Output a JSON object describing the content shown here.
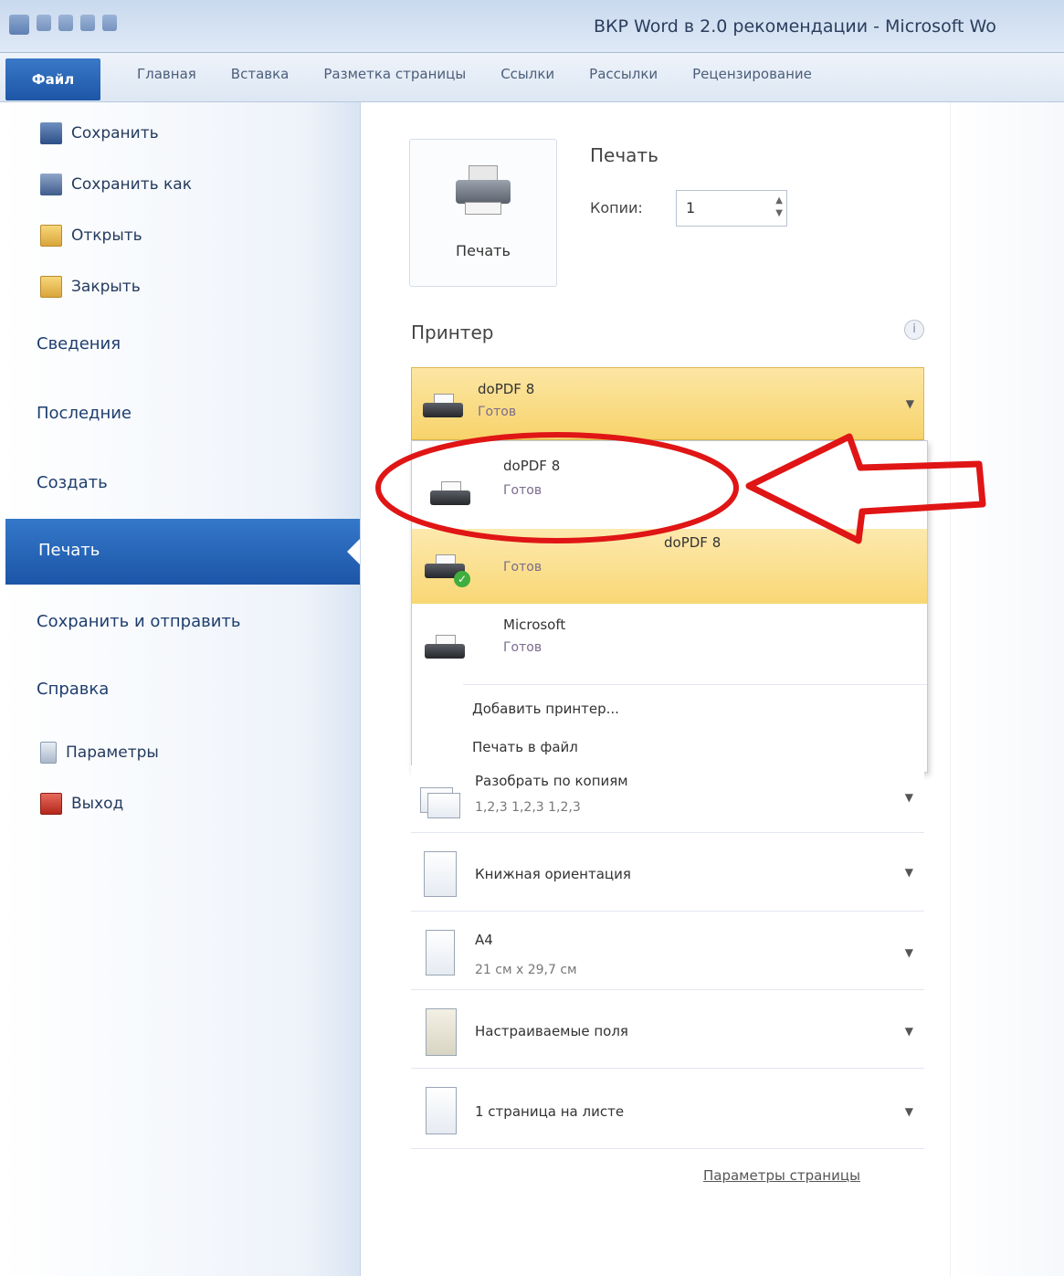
{
  "window": {
    "title": "ВКР Word в 2.0 рекомендации - Microsoft Wo"
  },
  "ribbon": {
    "file_tab": "Файл",
    "tabs": [
      "Главная",
      "Вставка",
      "Разметка страницы",
      "Ссылки",
      "Рассылки",
      "Рецензирование"
    ]
  },
  "backstage_nav": {
    "commands": [
      {
        "label": "Сохранить",
        "icon": "save-icon"
      },
      {
        "label": "Сохранить как",
        "icon": "save-as-icon"
      },
      {
        "label": "Открыть",
        "icon": "open-folder-icon"
      },
      {
        "label": "Закрыть",
        "icon": "close-folder-icon"
      }
    ],
    "items": [
      "Сведения",
      "Последние",
      "Создать",
      "Печать",
      "Сохранить и отправить",
      "Справка"
    ],
    "active_item": "Печать",
    "footer_commands": [
      {
        "label": "Параметры",
        "icon": "options-icon"
      },
      {
        "label": "Выход",
        "icon": "exit-icon"
      }
    ]
  },
  "print": {
    "button_label": "Печать",
    "heading": "Печать",
    "copies_label": "Копии:",
    "copies_value": "1"
  },
  "printer": {
    "section_label": "Принтер",
    "info_glyph": "i",
    "selected_name": "doPDF 8",
    "selected_status": "Готов",
    "dropdown": {
      "items": [
        {
          "name": "doPDF 8",
          "status": "Готов",
          "default": false
        },
        {
          "name": "doPDF 8",
          "status": "Готов",
          "default": true
        },
        {
          "name": "Microsoft",
          "status": "Готов",
          "default": false
        }
      ],
      "links": [
        "Добавить принтер...",
        "Печать в файл"
      ]
    }
  },
  "settings": [
    {
      "line1": "Разобрать по копиям",
      "line2": "1,2,3    1,2,3    1,2,3"
    },
    {
      "line1": "Книжная ориентация",
      "line2": ""
    },
    {
      "line1": "A4",
      "line2": "21 см x 29,7 см"
    },
    {
      "line1": "Настраиваемые поля",
      "line2": ""
    },
    {
      "line1": "1 страница на листе",
      "line2": ""
    }
  ],
  "page_setup_link": "Параметры страницы",
  "colors": {
    "accent_blue": "#1c55a7",
    "highlight_yellow": "#f7d36b",
    "annotation_red": "#e01515"
  }
}
